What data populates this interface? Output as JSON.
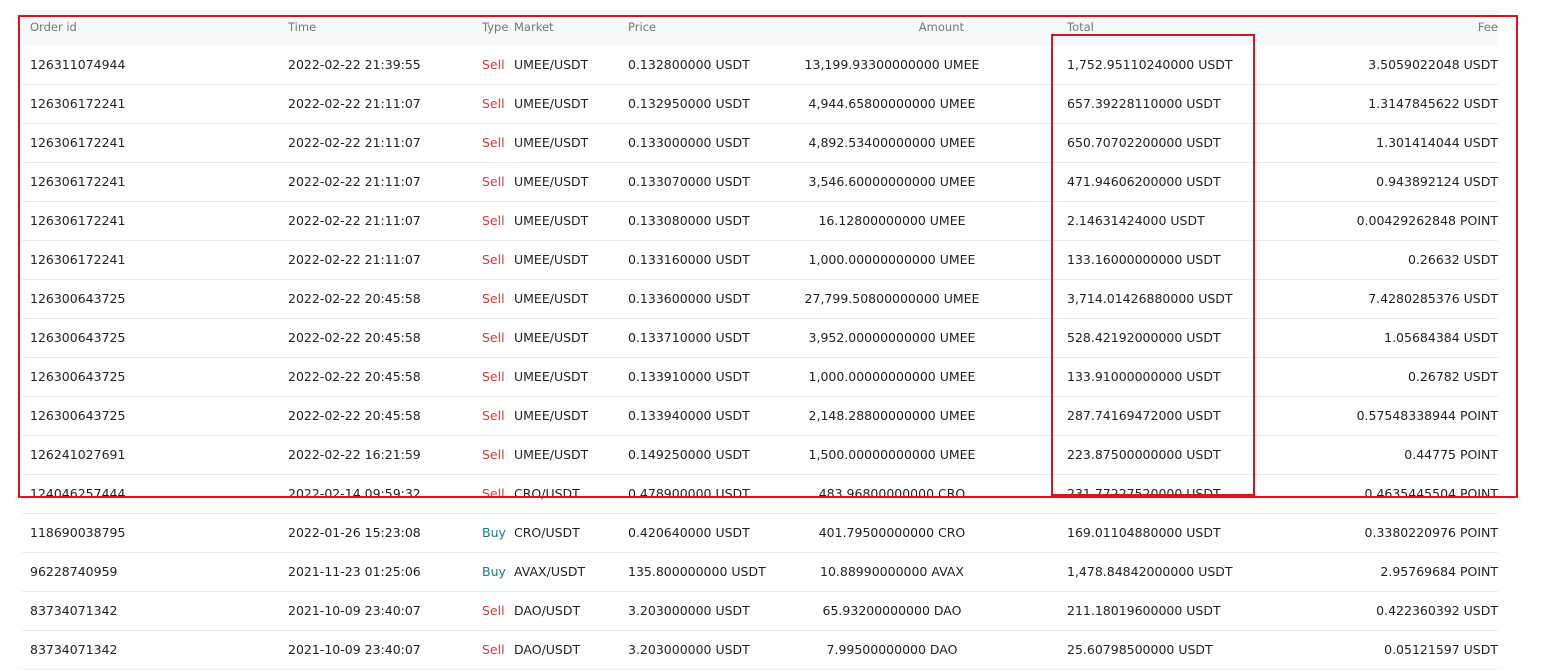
{
  "columns": {
    "order_id": "Order id",
    "time": "Time",
    "type": "Type",
    "market": "Market",
    "price": "Price",
    "amount": "Amount",
    "total": "Total",
    "fee": "Fee"
  },
  "colors": {
    "sell": "#d23a3a",
    "buy": "#1a7a86",
    "highlight_border": "#d9141c"
  },
  "rows": [
    {
      "order_id": "126311074944",
      "time": "2022-02-22 21:39:55",
      "type": "Sell",
      "market": "UMEE/USDT",
      "price": "0.132800000 USDT",
      "amount": "13,199.93300000000 UMEE",
      "total": "1,752.95110240000 USDT",
      "fee": "3.5059022048 USDT"
    },
    {
      "order_id": "126306172241",
      "time": "2022-02-22 21:11:07",
      "type": "Sell",
      "market": "UMEE/USDT",
      "price": "0.132950000 USDT",
      "amount": "4,944.65800000000 UMEE",
      "total": "657.39228110000 USDT",
      "fee": "1.3147845622 USDT"
    },
    {
      "order_id": "126306172241",
      "time": "2022-02-22 21:11:07",
      "type": "Sell",
      "market": "UMEE/USDT",
      "price": "0.133000000 USDT",
      "amount": "4,892.53400000000 UMEE",
      "total": "650.70702200000 USDT",
      "fee": "1.301414044 USDT"
    },
    {
      "order_id": "126306172241",
      "time": "2022-02-22 21:11:07",
      "type": "Sell",
      "market": "UMEE/USDT",
      "price": "0.133070000 USDT",
      "amount": "3,546.60000000000 UMEE",
      "total": "471.94606200000 USDT",
      "fee": "0.943892124 USDT"
    },
    {
      "order_id": "126306172241",
      "time": "2022-02-22 21:11:07",
      "type": "Sell",
      "market": "UMEE/USDT",
      "price": "0.133080000 USDT",
      "amount": "16.12800000000 UMEE",
      "total": "2.14631424000 USDT",
      "fee": "0.00429262848 POINT"
    },
    {
      "order_id": "126306172241",
      "time": "2022-02-22 21:11:07",
      "type": "Sell",
      "market": "UMEE/USDT",
      "price": "0.133160000 USDT",
      "amount": "1,000.00000000000 UMEE",
      "total": "133.16000000000 USDT",
      "fee": "0.26632 USDT"
    },
    {
      "order_id": "126300643725",
      "time": "2022-02-22 20:45:58",
      "type": "Sell",
      "market": "UMEE/USDT",
      "price": "0.133600000 USDT",
      "amount": "27,799.50800000000 UMEE",
      "total": "3,714.01426880000 USDT",
      "fee": "7.4280285376 USDT"
    },
    {
      "order_id": "126300643725",
      "time": "2022-02-22 20:45:58",
      "type": "Sell",
      "market": "UMEE/USDT",
      "price": "0.133710000 USDT",
      "amount": "3,952.00000000000 UMEE",
      "total": "528.42192000000 USDT",
      "fee": "1.05684384 USDT"
    },
    {
      "order_id": "126300643725",
      "time": "2022-02-22 20:45:58",
      "type": "Sell",
      "market": "UMEE/USDT",
      "price": "0.133910000 USDT",
      "amount": "1,000.00000000000 UMEE",
      "total": "133.91000000000 USDT",
      "fee": "0.26782 USDT"
    },
    {
      "order_id": "126300643725",
      "time": "2022-02-22 20:45:58",
      "type": "Sell",
      "market": "UMEE/USDT",
      "price": "0.133940000 USDT",
      "amount": "2,148.28800000000 UMEE",
      "total": "287.74169472000 USDT",
      "fee": "0.57548338944 POINT"
    },
    {
      "order_id": "126241027691",
      "time": "2022-02-22 16:21:59",
      "type": "Sell",
      "market": "UMEE/USDT",
      "price": "0.149250000 USDT",
      "amount": "1,500.00000000000 UMEE",
      "total": "223.87500000000 USDT",
      "fee": "0.44775 POINT"
    },
    {
      "order_id": "124046257444",
      "time": "2022-02-14 09:59:32",
      "type": "Sell",
      "market": "CRO/USDT",
      "price": "0.478900000 USDT",
      "amount": "483.96800000000 CRO",
      "total": "231.77227520000 USDT",
      "fee": "0.4635445504 POINT"
    },
    {
      "order_id": "118690038795",
      "time": "2022-01-26 15:23:08",
      "type": "Buy",
      "market": "CRO/USDT",
      "price": "0.420640000 USDT",
      "amount": "401.79500000000 CRO",
      "total": "169.01104880000 USDT",
      "fee": "0.3380220976 POINT"
    },
    {
      "order_id": "96228740959",
      "time": "2021-11-23 01:25:06",
      "type": "Buy",
      "market": "AVAX/USDT",
      "price": "135.800000000 USDT",
      "amount": "10.88990000000 AVAX",
      "total": "1,478.84842000000 USDT",
      "fee": "2.95769684 POINT"
    },
    {
      "order_id": "83734071342",
      "time": "2021-10-09 23:40:07",
      "type": "Sell",
      "market": "DAO/USDT",
      "price": "3.203000000 USDT",
      "amount": "65.93200000000 DAO",
      "total": "211.18019600000 USDT",
      "fee": "0.422360392 USDT"
    },
    {
      "order_id": "83734071342",
      "time": "2021-10-09 23:40:07",
      "type": "Sell",
      "market": "DAO/USDT",
      "price": "3.203000000 USDT",
      "amount": "7.99500000000 DAO",
      "total": "25.60798500000 USDT",
      "fee": "0.05121597 USDT"
    }
  ]
}
